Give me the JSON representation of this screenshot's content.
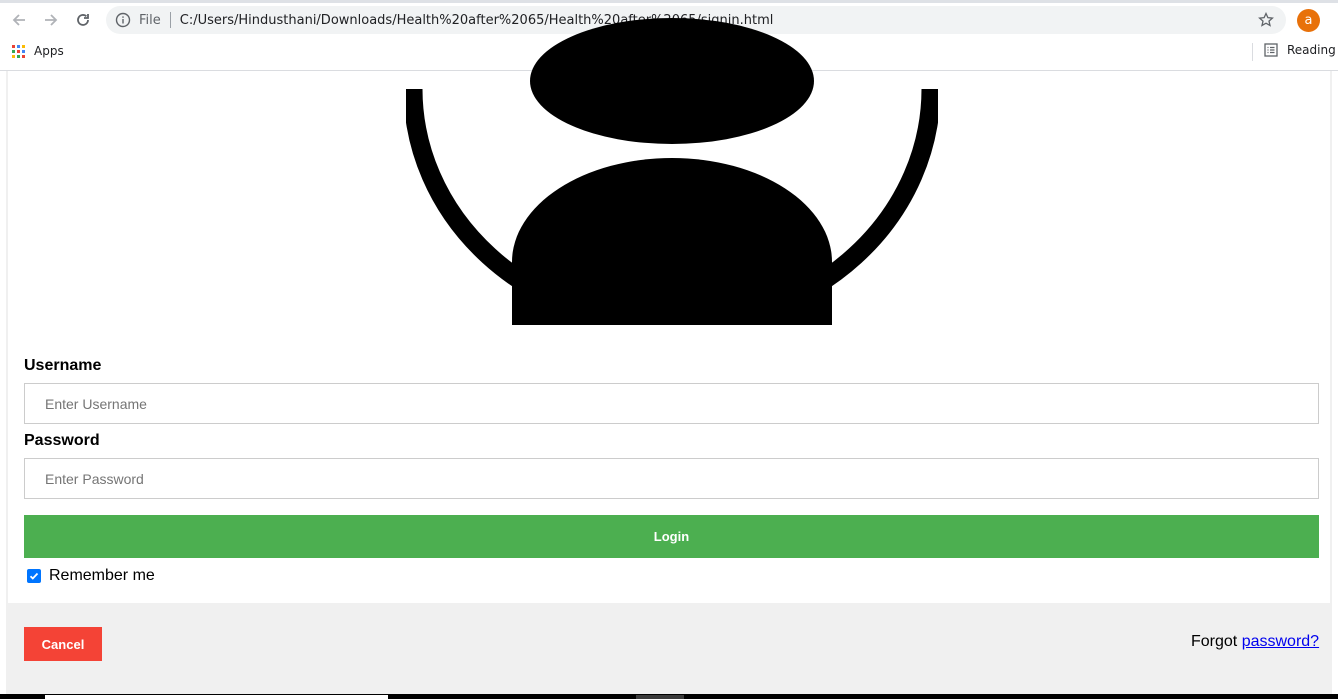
{
  "browser": {
    "scheme_label": "File",
    "url": "C:/Users/Hindusthani/Downloads/Health%20after%2065/Health%20after%2065/signin.html",
    "profile_initial": "a",
    "bookmarks": {
      "apps_label": "Apps",
      "reading_list_label": "Reading li"
    }
  },
  "form": {
    "username_label": "Username",
    "username_placeholder": "Enter Username",
    "password_label": "Password",
    "password_placeholder": "Enter Password",
    "login_label": "Login",
    "remember_label": "Remember me",
    "remember_checked": true
  },
  "footer": {
    "cancel_label": "Cancel",
    "forgot_prefix": "Forgot",
    "forgot_link": "password?"
  },
  "colors": {
    "login": "#4caf50",
    "cancel": "#f44336",
    "link": "#0000ee",
    "avatar_badge": "#e8710a"
  }
}
